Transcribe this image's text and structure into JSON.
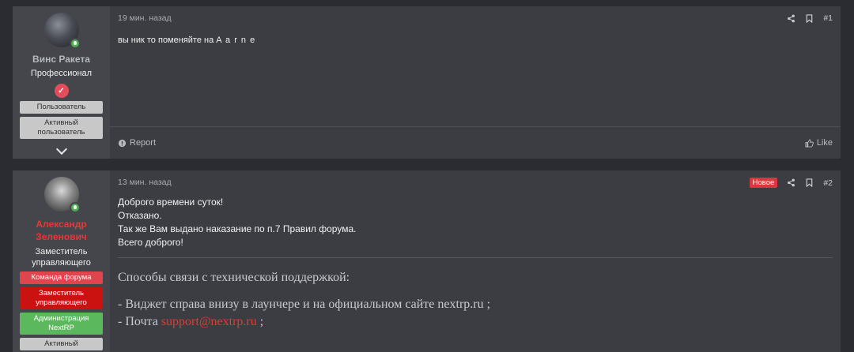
{
  "posts": [
    {
      "author": "Винс Ракета",
      "user_title": "Профессионал",
      "tags": [
        "Пользователь",
        "Активный пользователь"
      ],
      "time": "19 мин. назад",
      "number": "#1",
      "content": "вы ник то поменяйте на ",
      "content_spaced": "A a r n e",
      "report": "Report",
      "like": "Like"
    },
    {
      "author": "Александр Зеленович",
      "user_title": "Заместитель управляющего",
      "tags": [
        "Команда форума",
        "Заместитель управляющего",
        "Администрация NextRP",
        "Активный"
      ],
      "time": "13 мин. назад",
      "new_label": "Новое",
      "number": "#2",
      "lines": [
        "Доброго времени суток!",
        "Отказано.",
        "Так же Вам выдано наказание по п.7 Правил форума.",
        "Всего доброго!"
      ],
      "support_heading": "Способы связи с технической поддержкой:",
      "support_line1": "- Виджет справа внизу в лаунчере и на официальном сайте nextrp.ru ;",
      "support_line2_prefix": "- Почта ",
      "support_email": "support@nextrp.ru",
      "support_line2_suffix": " ;"
    }
  ],
  "colors": {
    "accent_red": "#e53935",
    "online": "#4caf50"
  }
}
